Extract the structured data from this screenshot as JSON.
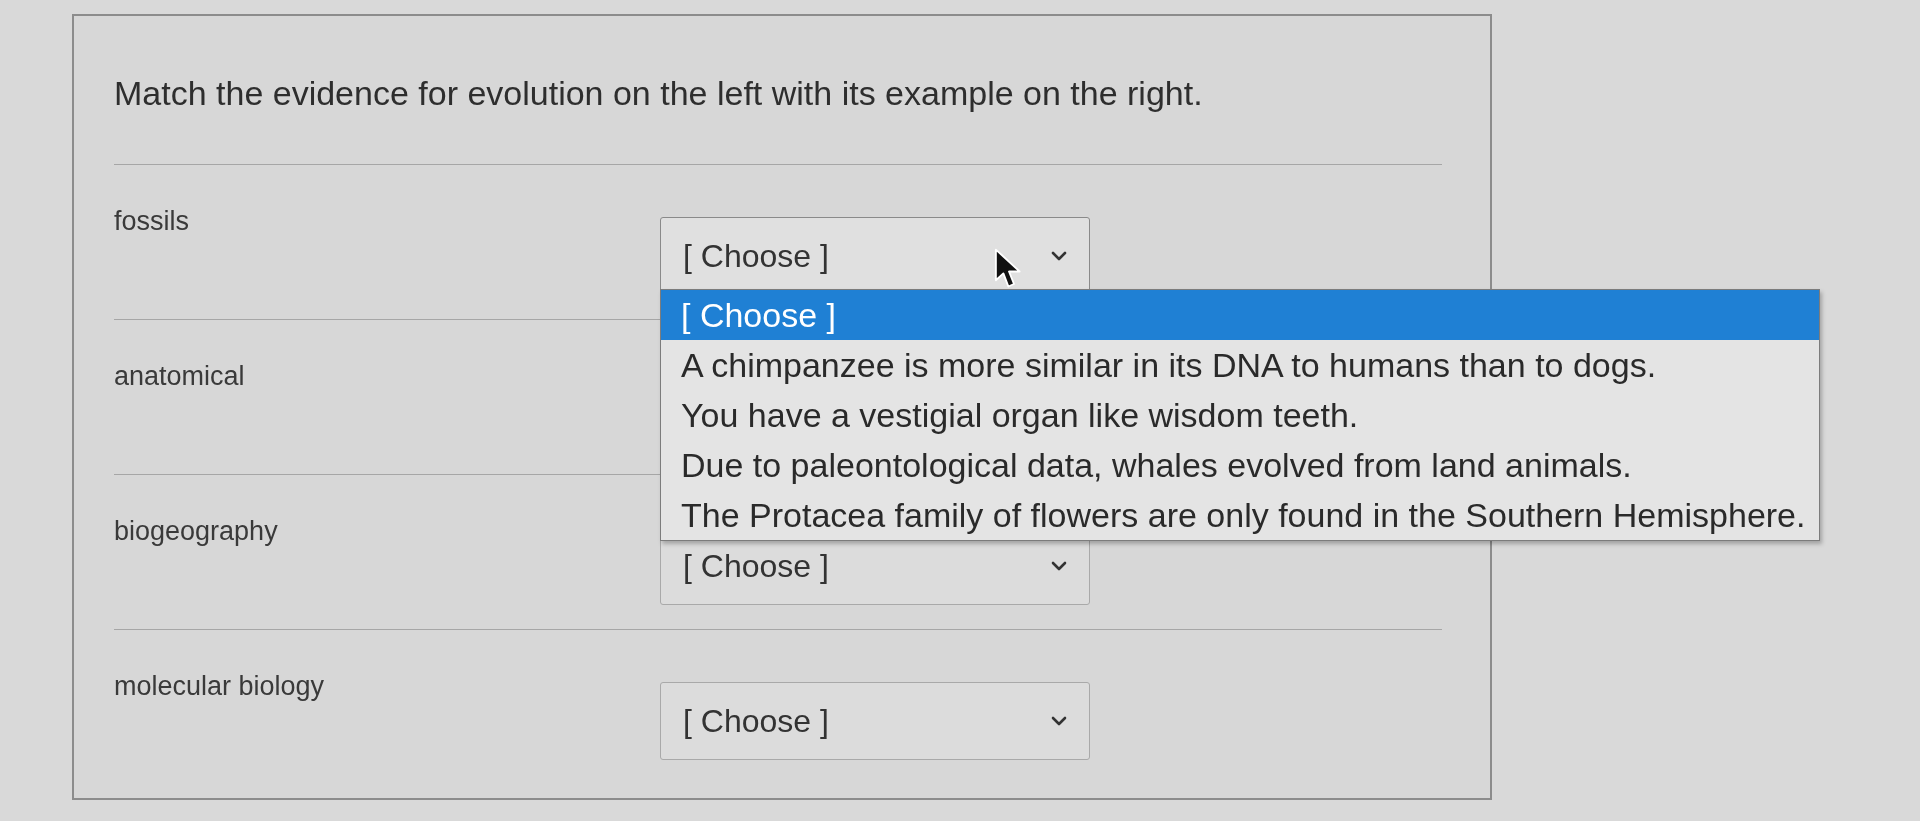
{
  "question": {
    "text": "Match the evidence for evolution on the left with its example on the right."
  },
  "pairs": [
    {
      "label": "fossils",
      "select": {
        "value": "[ Choose ]",
        "expanded": true,
        "options": [
          {
            "label": "[ Choose ]",
            "selected": true
          },
          {
            "label": "A chimpanzee is more similar in its DNA to humans than to dogs.",
            "selected": false
          },
          {
            "label": "You have a vestigial organ like wisdom teeth.",
            "selected": false
          },
          {
            "label": "Due to paleontological data, whales evolved from land animals.",
            "selected": false
          },
          {
            "label": "The Protacea family of flowers are only found in the Southern Hemisphere.",
            "selected": false
          }
        ]
      }
    },
    {
      "label": "anatomical"
    },
    {
      "label": "biogeography",
      "select": {
        "value": "[ Choose ]",
        "expanded": false
      }
    },
    {
      "label": "molecular biology",
      "select": {
        "value": "[ Choose ]",
        "expanded": false
      }
    }
  ]
}
